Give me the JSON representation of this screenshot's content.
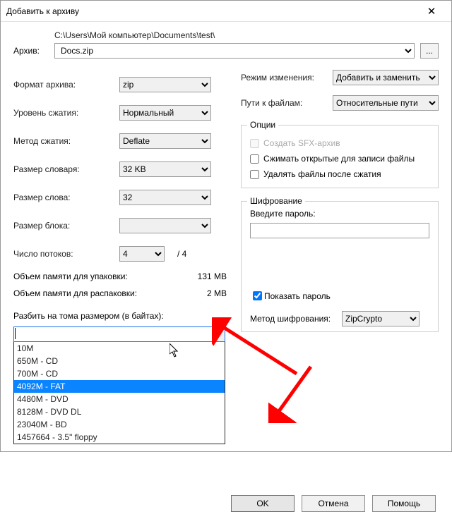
{
  "window": {
    "title": "Добавить к архиву"
  },
  "archive": {
    "label": "Архив:",
    "path": "C:\\Users\\Мой компьютер\\Documents\\test\\",
    "filename": "Docs.zip",
    "browse": "..."
  },
  "left": {
    "format_label": "Формат архива:",
    "format_value": "zip",
    "level_label": "Уровень сжатия:",
    "level_value": "Нормальный",
    "method_label": "Метод сжатия:",
    "method_value": "Deflate",
    "dict_label": "Размер словаря:",
    "dict_value": "32 KB",
    "word_label": "Размер слова:",
    "word_value": "32",
    "block_label": "Размер блока:",
    "block_value": "",
    "threads_label": "Число потоков:",
    "threads_value": "4",
    "threads_total": "/ 4",
    "pack_label": "Объем памяти для упаковки:",
    "pack_value": "131 MB",
    "unpack_label": "Объем памяти для распаковки:",
    "unpack_value": "2 MB",
    "split_label": "Разбить на тома размером (в байтах):",
    "split_value": "",
    "split_options": [
      "10M",
      "650M - CD",
      "700M - CD",
      "4092M - FAT",
      "4480M - DVD",
      "8128M - DVD DL",
      "23040M - BD",
      "1457664 - 3.5\" floppy"
    ],
    "split_selected_index": 3
  },
  "right": {
    "mode_label": "Режим изменения:",
    "mode_value": "Добавить и заменить",
    "paths_label": "Пути к файлам:",
    "paths_value": "Относительные пути",
    "options_legend": "Опции",
    "opt_sfx": "Создать SFX-архив",
    "opt_compress_open": "Сжимать открытые для записи файлы",
    "opt_delete_after": "Удалять файлы после сжатия",
    "enc_legend": "Шифрование",
    "pw_label": "Введите пароль:",
    "pw_value": "",
    "show_pw": "Показать пароль",
    "enc_method_label": "Метод шифрования:",
    "enc_method_value": "ZipCrypto"
  },
  "buttons": {
    "ok": "OK",
    "cancel": "Отмена",
    "help": "Помощь"
  }
}
